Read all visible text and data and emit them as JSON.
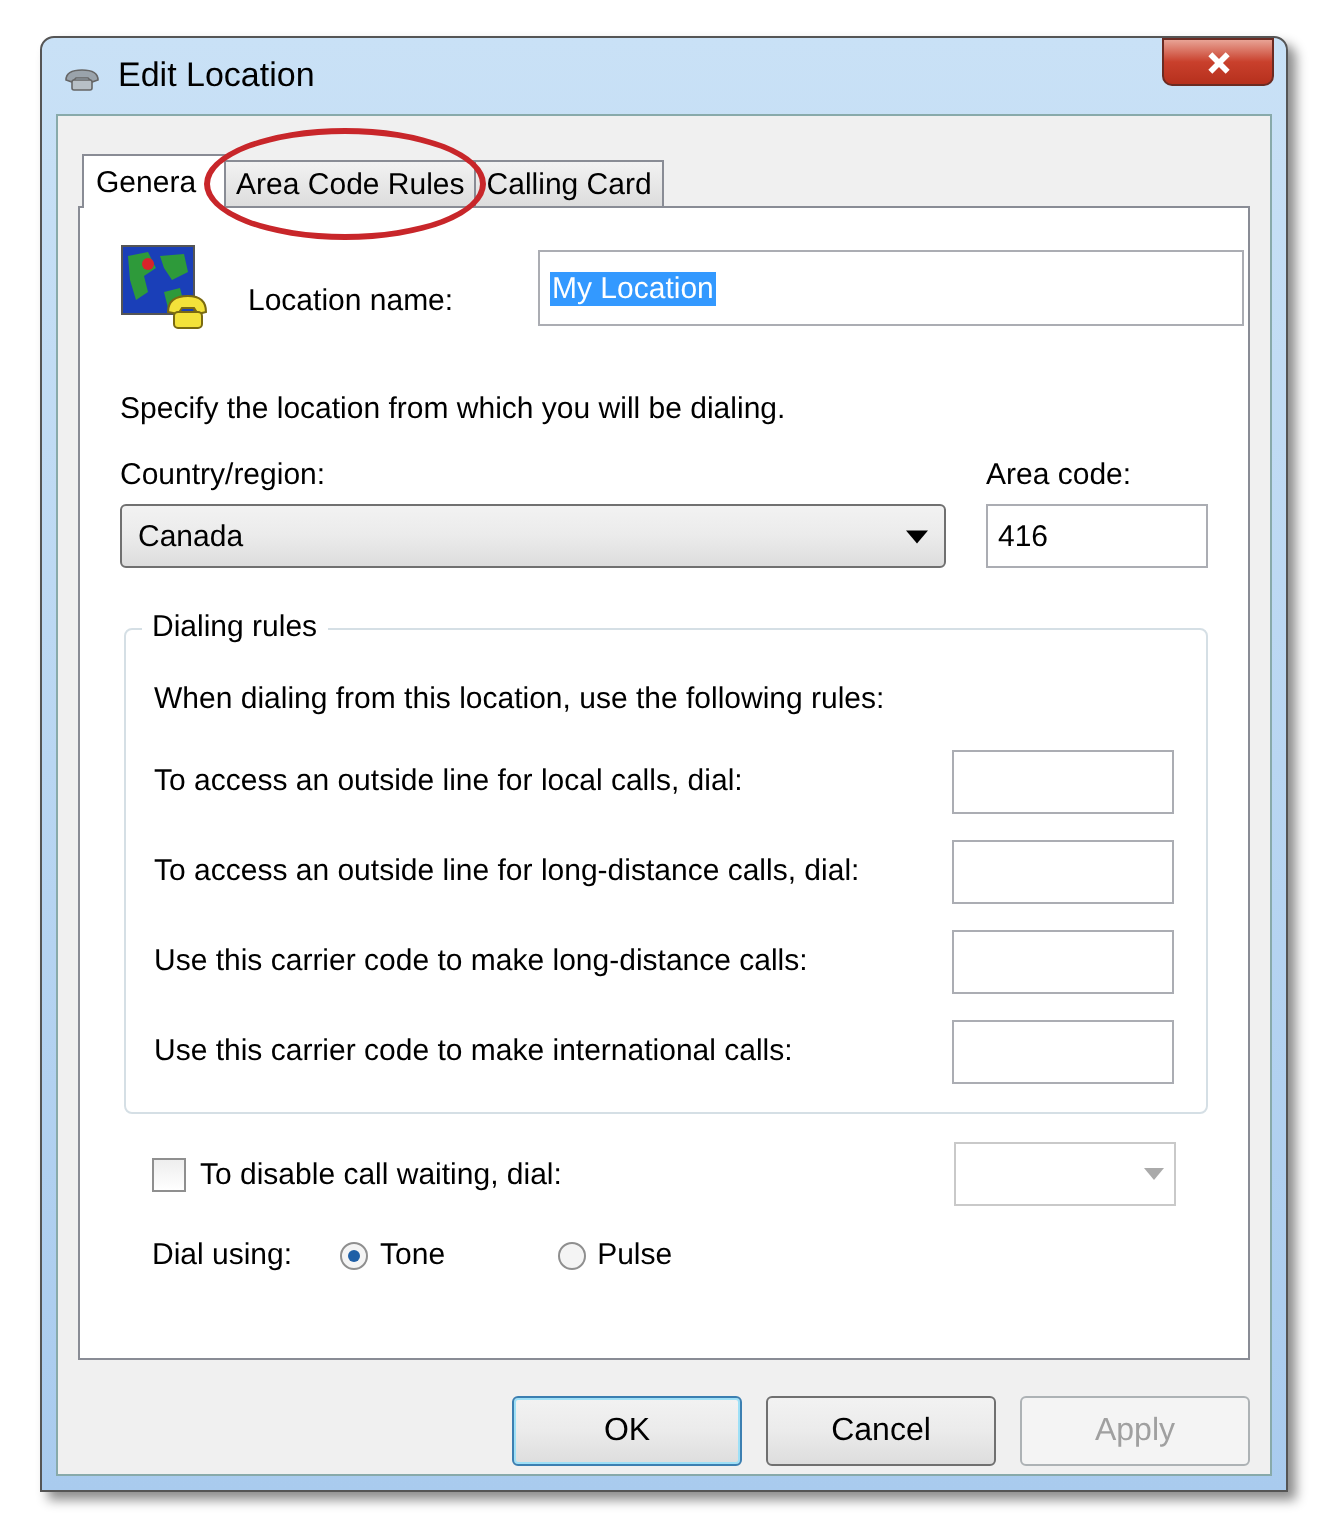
{
  "window": {
    "title": "Edit Location"
  },
  "tabs": [
    {
      "label": "Genera",
      "selected": true,
      "circled": false
    },
    {
      "label": "Area Code Rules",
      "selected": false,
      "circled": true
    },
    {
      "label": "Calling Card",
      "selected": false,
      "circled": false
    }
  ],
  "location_name": {
    "label": "Location name:",
    "value": "My Location",
    "value_selected": true
  },
  "instruction": "Specify the location from which you will be dialing.",
  "country": {
    "label": "Country/region:",
    "value": "Canada"
  },
  "area_code": {
    "label": "Area code:",
    "value": "416"
  },
  "dialing_rules": {
    "title": "Dialing rules",
    "intro": "When dialing from this location, use the following rules:",
    "rows": [
      {
        "label": "To access an outside line for local calls, dial:"
      },
      {
        "label": "To access an outside line for long-distance calls, dial:"
      },
      {
        "label": "Use this carrier code to make long-distance calls:"
      },
      {
        "label": "Use this carrier code to make international calls:"
      }
    ]
  },
  "call_waiting": {
    "label": "To disable call waiting, dial:",
    "checked": false
  },
  "dial_using": {
    "label": "Dial using:",
    "options": [
      {
        "label": "Tone",
        "selected": true
      },
      {
        "label": "Pulse",
        "selected": false
      }
    ]
  },
  "buttons": [
    {
      "label": "OK",
      "default": true,
      "disabled": false
    },
    {
      "label": "Cancel",
      "default": false,
      "disabled": false
    },
    {
      "label": "Apply",
      "default": false,
      "disabled": true
    }
  ]
}
